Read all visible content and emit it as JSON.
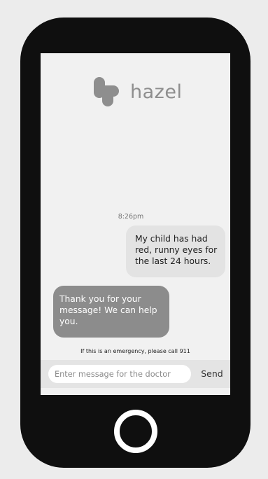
{
  "app": {
    "name": "hazel",
    "logo_icon": "medical-cross-logo-icon"
  },
  "chat": {
    "timestamp": "8:26pm",
    "messages": [
      {
        "sender": "user",
        "text": "My child has had red, runny eyes for the last 24 hours."
      },
      {
        "sender": "bot",
        "text": "Thank you for your message! We can help you."
      }
    ]
  },
  "emergency_note": "If this is an emergency, please call 911",
  "composer": {
    "placeholder": "Enter message for the doctor",
    "value": "",
    "send_label": "Send"
  },
  "device": {
    "home_button_icon": "home-button-icon"
  },
  "colors": {
    "phone_body": "#0f0f0f",
    "screen_bg": "#f1f1f1",
    "user_bubble": "#e3e3e3",
    "bot_bubble": "#8c8c8c",
    "logo": "#8e8e8e"
  }
}
